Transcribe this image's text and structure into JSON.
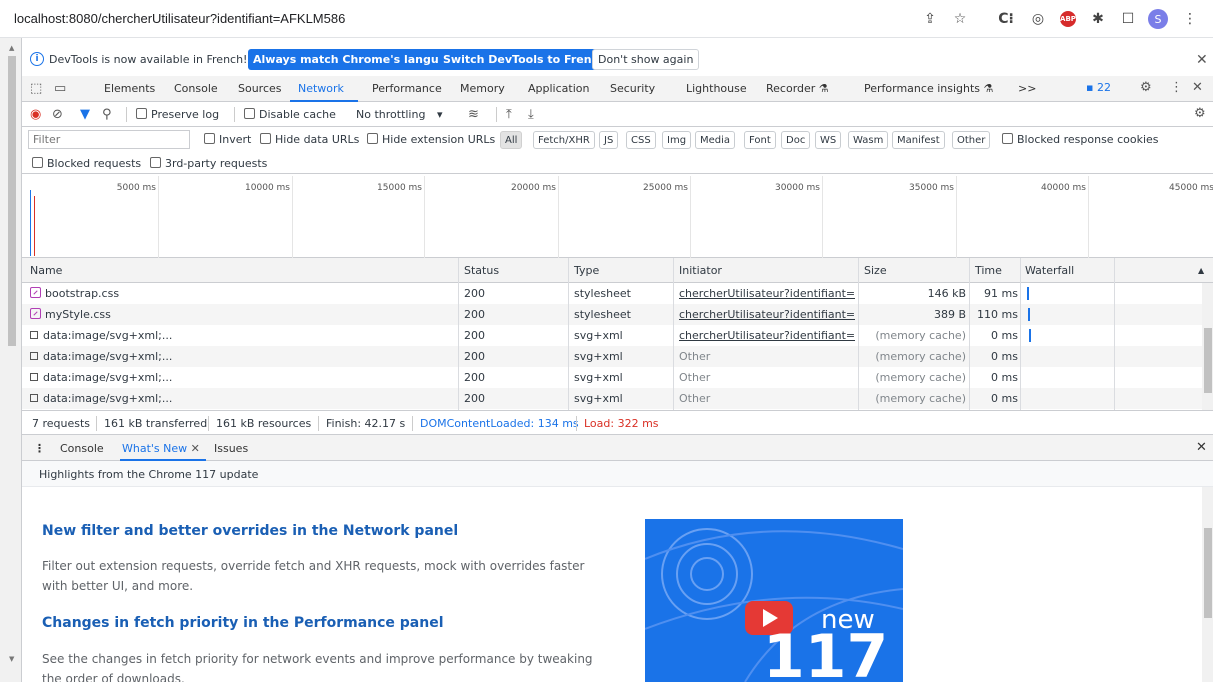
{
  "browser": {
    "url": "localhost:8080/chercherUtilisateur?identifiant=AFKLM586",
    "profile_initial": "S",
    "abp_label": "ABP",
    "extensions_label": "C⁝"
  },
  "infobar": {
    "message": "DevTools is now available in French!",
    "always_match": "Always match Chrome's language",
    "switch_french": "Switch DevTools to French",
    "dont_show": "Don't show again"
  },
  "tabs": [
    "Elements",
    "Console",
    "Sources",
    "Network",
    "Performance",
    "Memory",
    "Application",
    "Security",
    "Lighthouse",
    "Recorder",
    "Performance insights"
  ],
  "tabs_more": ">>",
  "issues_count": "22",
  "toolbar": {
    "preserve_log": "Preserve log",
    "disable_cache": "Disable cache",
    "throttling": "No throttling"
  },
  "filter": {
    "placeholder": "Filter",
    "invert": "Invert",
    "hide_data_urls": "Hide data URLs",
    "hide_extension_urls": "Hide extension URLs",
    "types": [
      "All",
      "Fetch/XHR",
      "JS",
      "CSS",
      "Img",
      "Media",
      "Font",
      "Doc",
      "WS",
      "Wasm",
      "Manifest",
      "Other"
    ],
    "blocked_cookies": "Blocked response cookies",
    "blocked_requests": "Blocked requests",
    "third_party": "3rd-party requests"
  },
  "timeline_ticks": [
    "5000 ms",
    "10000 ms",
    "15000 ms",
    "20000 ms",
    "25000 ms",
    "30000 ms",
    "35000 ms",
    "40000 ms",
    "45000 ms"
  ],
  "table": {
    "columns": [
      "Name",
      "Status",
      "Type",
      "Initiator",
      "Size",
      "Time",
      "Waterfall"
    ],
    "rows": [
      {
        "name": "bootstrap.css",
        "status": "200",
        "type": "stylesheet",
        "initiator": "chercherUtilisateur?identifiant=...",
        "size": "146 kB",
        "time": "91 ms"
      },
      {
        "name": "myStyle.css",
        "status": "200",
        "type": "stylesheet",
        "initiator": "chercherUtilisateur?identifiant=...",
        "size": "389 B",
        "time": "110 ms"
      },
      {
        "name": "data:image/svg+xml;...",
        "status": "200",
        "type": "svg+xml",
        "initiator": "chercherUtilisateur?identifiant=...",
        "size": "(memory cache)",
        "time": "0 ms"
      },
      {
        "name": "data:image/svg+xml;...",
        "status": "200",
        "type": "svg+xml",
        "initiator": "Other",
        "size": "(memory cache)",
        "time": "0 ms"
      },
      {
        "name": "data:image/svg+xml;...",
        "status": "200",
        "type": "svg+xml",
        "initiator": "Other",
        "size": "(memory cache)",
        "time": "0 ms"
      },
      {
        "name": "data:image/svg+xml;...",
        "status": "200",
        "type": "svg+xml",
        "initiator": "Other",
        "size": "(memory cache)",
        "time": "0 ms"
      }
    ]
  },
  "status": {
    "requests": "7 requests",
    "transferred": "161 kB transferred",
    "resources": "161 kB resources",
    "finish": "Finish: 42.17 s",
    "dcl": "DOMContentLoaded: 134 ms",
    "load": "Load: 322 ms"
  },
  "drawer": {
    "tabs": [
      "Console",
      "What's New",
      "Issues"
    ],
    "highlights": "Highlights from the Chrome 117 update"
  },
  "whatsnew": {
    "h1": "New filter and better overrides in the Network panel",
    "p1": "Filter out extension requests, override fetch and XHR requests, mock with overrides faster with better UI, and more.",
    "h2": "Changes in fetch priority in the Performance panel",
    "p2": "See the changes in fetch priority for network events and improve performance by tweaking the order of downloads.",
    "video_new": "new",
    "video_num": "117"
  },
  "colors": {
    "accent": "#1a73e8",
    "load_red": "#d93025",
    "heading_blue": "#1a5fb4"
  }
}
